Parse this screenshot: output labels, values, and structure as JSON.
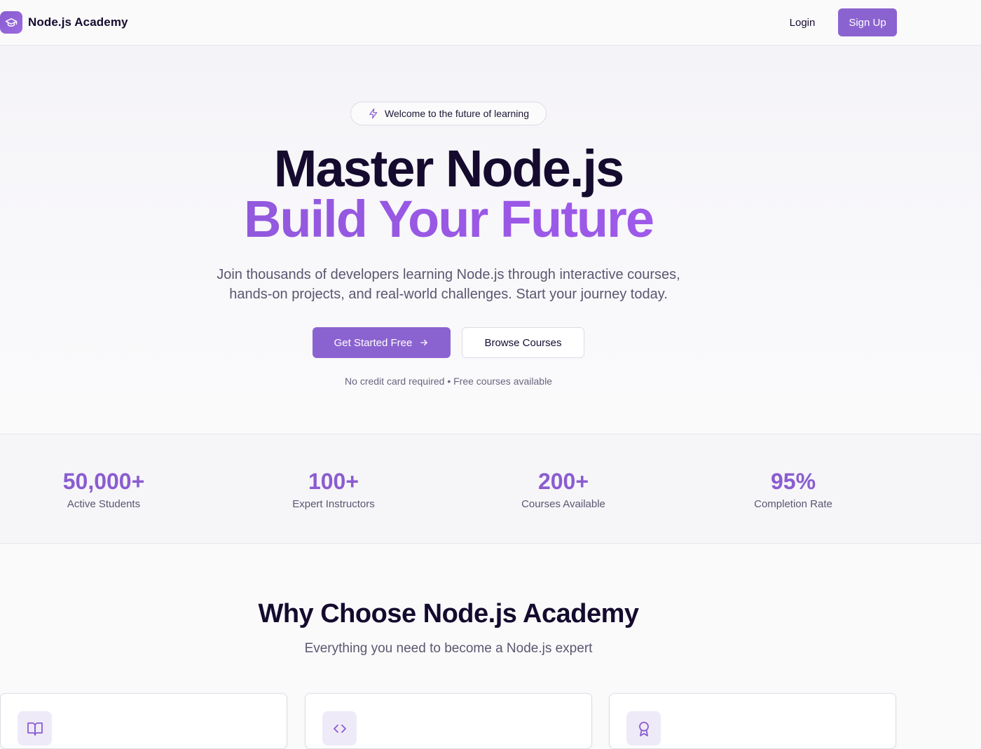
{
  "header": {
    "brand_name": "Node.js Academy",
    "login_label": "Login",
    "signup_label": "Sign Up"
  },
  "hero": {
    "badge_text": "Welcome to the future of learning",
    "title_line1": "Master Node.js",
    "title_line2": "Build Your Future",
    "description_line1": "Join thousands of developers learning Node.js through interactive courses,",
    "description_line2": "hands-on projects, and real-world challenges. Start your journey today.",
    "primary_cta": "Get Started Free",
    "secondary_cta": "Browse Courses",
    "note": "No credit card required • Free courses available"
  },
  "stats": [
    {
      "value": "50,000+",
      "label": "Active Students"
    },
    {
      "value": "100+",
      "label": "Expert Instructors"
    },
    {
      "value": "200+",
      "label": "Courses Available"
    },
    {
      "value": "95%",
      "label": "Completion Rate"
    }
  ],
  "features": {
    "title": "Why Choose Node.js Academy",
    "subtitle": "Everything you need to become a Node.js expert",
    "cards": [
      {
        "icon": "book-open-icon"
      },
      {
        "icon": "code-icon"
      },
      {
        "icon": "award-icon"
      }
    ]
  },
  "colors": {
    "accent": "#8b63d0",
    "gradient_start": "#8a5ad4",
    "gradient_end": "#a35df0",
    "heading": "#150b2e"
  }
}
